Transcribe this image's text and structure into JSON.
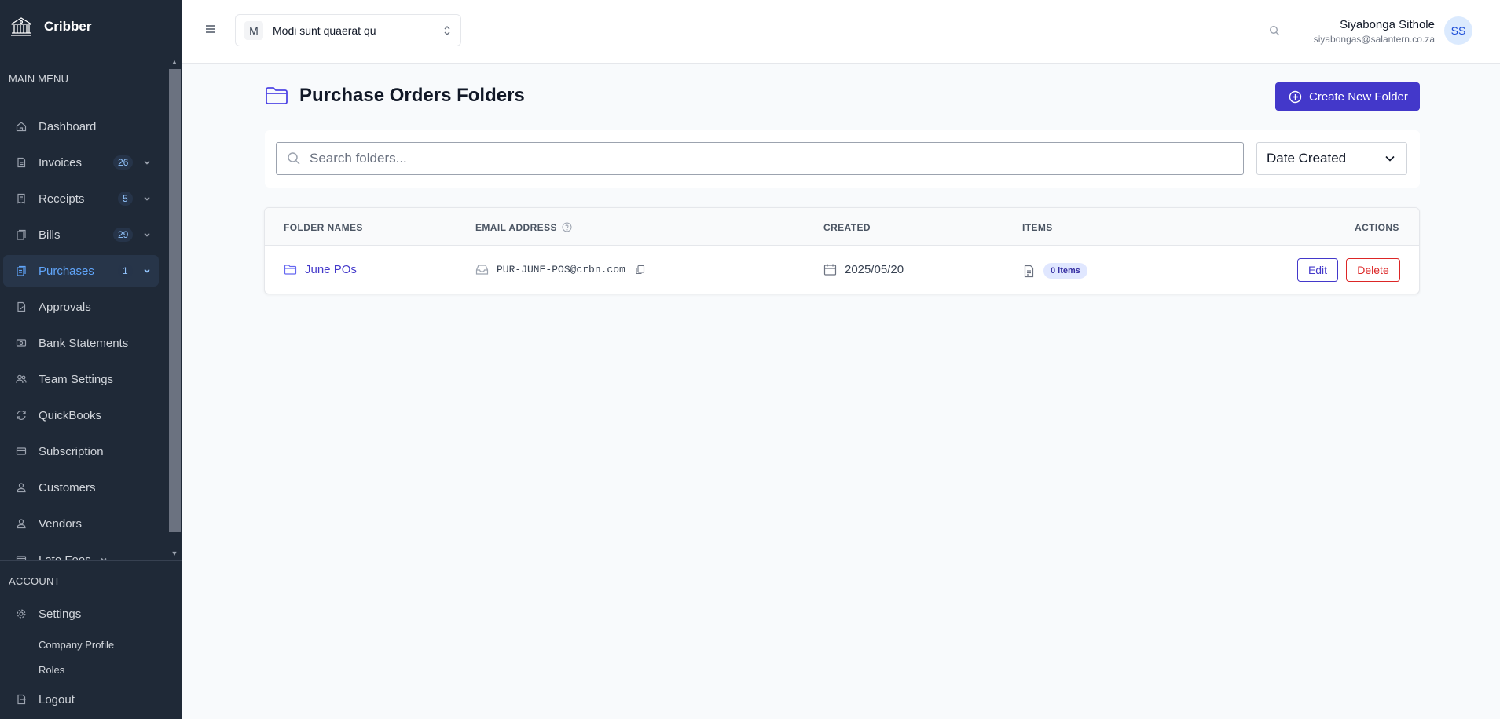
{
  "app": {
    "name": "Cribber"
  },
  "colors": {
    "sidebar_bg": "#1f2937",
    "accent": "#4338ca",
    "danger": "#dc2626",
    "active_nav": "#60a5fa"
  },
  "sidebar": {
    "main_menu_label": "MAIN MENU",
    "items": [
      {
        "label": "Dashboard",
        "icon": "home-icon"
      },
      {
        "label": "Invoices",
        "icon": "document-icon",
        "badge": "26",
        "expandable": true
      },
      {
        "label": "Receipts",
        "icon": "receipt-icon",
        "badge": "5",
        "expandable": true
      },
      {
        "label": "Bills",
        "icon": "bills-icon",
        "badge": "29",
        "expandable": true
      },
      {
        "label": "Purchases",
        "icon": "purchases-icon",
        "badge": "1",
        "expandable": true,
        "active": true
      },
      {
        "label": "Approvals",
        "icon": "approvals-icon"
      },
      {
        "label": "Bank Statements",
        "icon": "bank-icon"
      },
      {
        "label": "Team Settings",
        "icon": "team-icon"
      },
      {
        "label": "QuickBooks",
        "icon": "sync-icon"
      },
      {
        "label": "Subscription",
        "icon": "card-icon"
      },
      {
        "label": "Customers",
        "icon": "user-icon"
      },
      {
        "label": "Vendors",
        "icon": "user-icon"
      },
      {
        "label": "Late Fees",
        "icon": "card-icon",
        "expandable": true
      }
    ],
    "account_label": "ACCOUNT",
    "settings_label": "Settings",
    "settings_sub": [
      "Company Profile",
      "Roles"
    ],
    "logout_label": "Logout"
  },
  "topbar": {
    "org_initial": "M",
    "org_name": "Modi sunt quaerat qu",
    "user_name": "Siyabonga Sithole",
    "user_email": "siyabongas@salantern.co.za",
    "user_initials": "SS"
  },
  "page": {
    "title": "Purchase Orders Folders",
    "create_label": "Create New Folder",
    "search_placeholder": "Search folders...",
    "sort_selected": "Date Created"
  },
  "table": {
    "headers": {
      "folder": "FOLDER NAMES",
      "email": "EMAIL ADDRESS",
      "created": "CREATED",
      "items": "ITEMS",
      "actions": "ACTIONS"
    },
    "rows": [
      {
        "folder": "June POs",
        "email": "PUR-JUNE-POS@crbn.com",
        "created": "2025/05/20",
        "items": "0 items",
        "edit": "Edit",
        "delete": "Delete"
      }
    ]
  }
}
